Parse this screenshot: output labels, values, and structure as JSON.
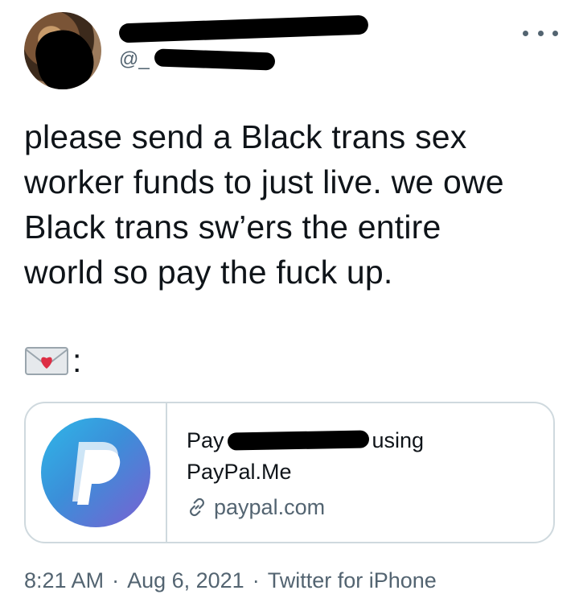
{
  "author": {
    "display_name": "",
    "handle_prefix": "@_",
    "avatar_icon": "user-avatar"
  },
  "more_icon": "more-options-icon",
  "tweet": {
    "text": "please send a Black trans sex\nworker funds to just live. we owe\nBlack trans sw’ers the entire\nworld so pay the fuck up.",
    "emoji_line_suffix": ":",
    "emoji_icon": "envelope-with-heart-icon"
  },
  "card": {
    "title_prefix": "Pay",
    "title_suffix": "using",
    "title_line2": "PayPal.Me",
    "domain": "paypal.com",
    "logo_icon": "paypal-logo",
    "link_icon": "link-icon"
  },
  "meta": {
    "time": "8:21 AM",
    "date": "Aug 6, 2021",
    "source": "Twitter for iPhone",
    "separator": "·"
  },
  "colors": {
    "text": "#0f1419",
    "secondary": "#536471",
    "border": "#cfd9de",
    "redaction": "#000000"
  }
}
